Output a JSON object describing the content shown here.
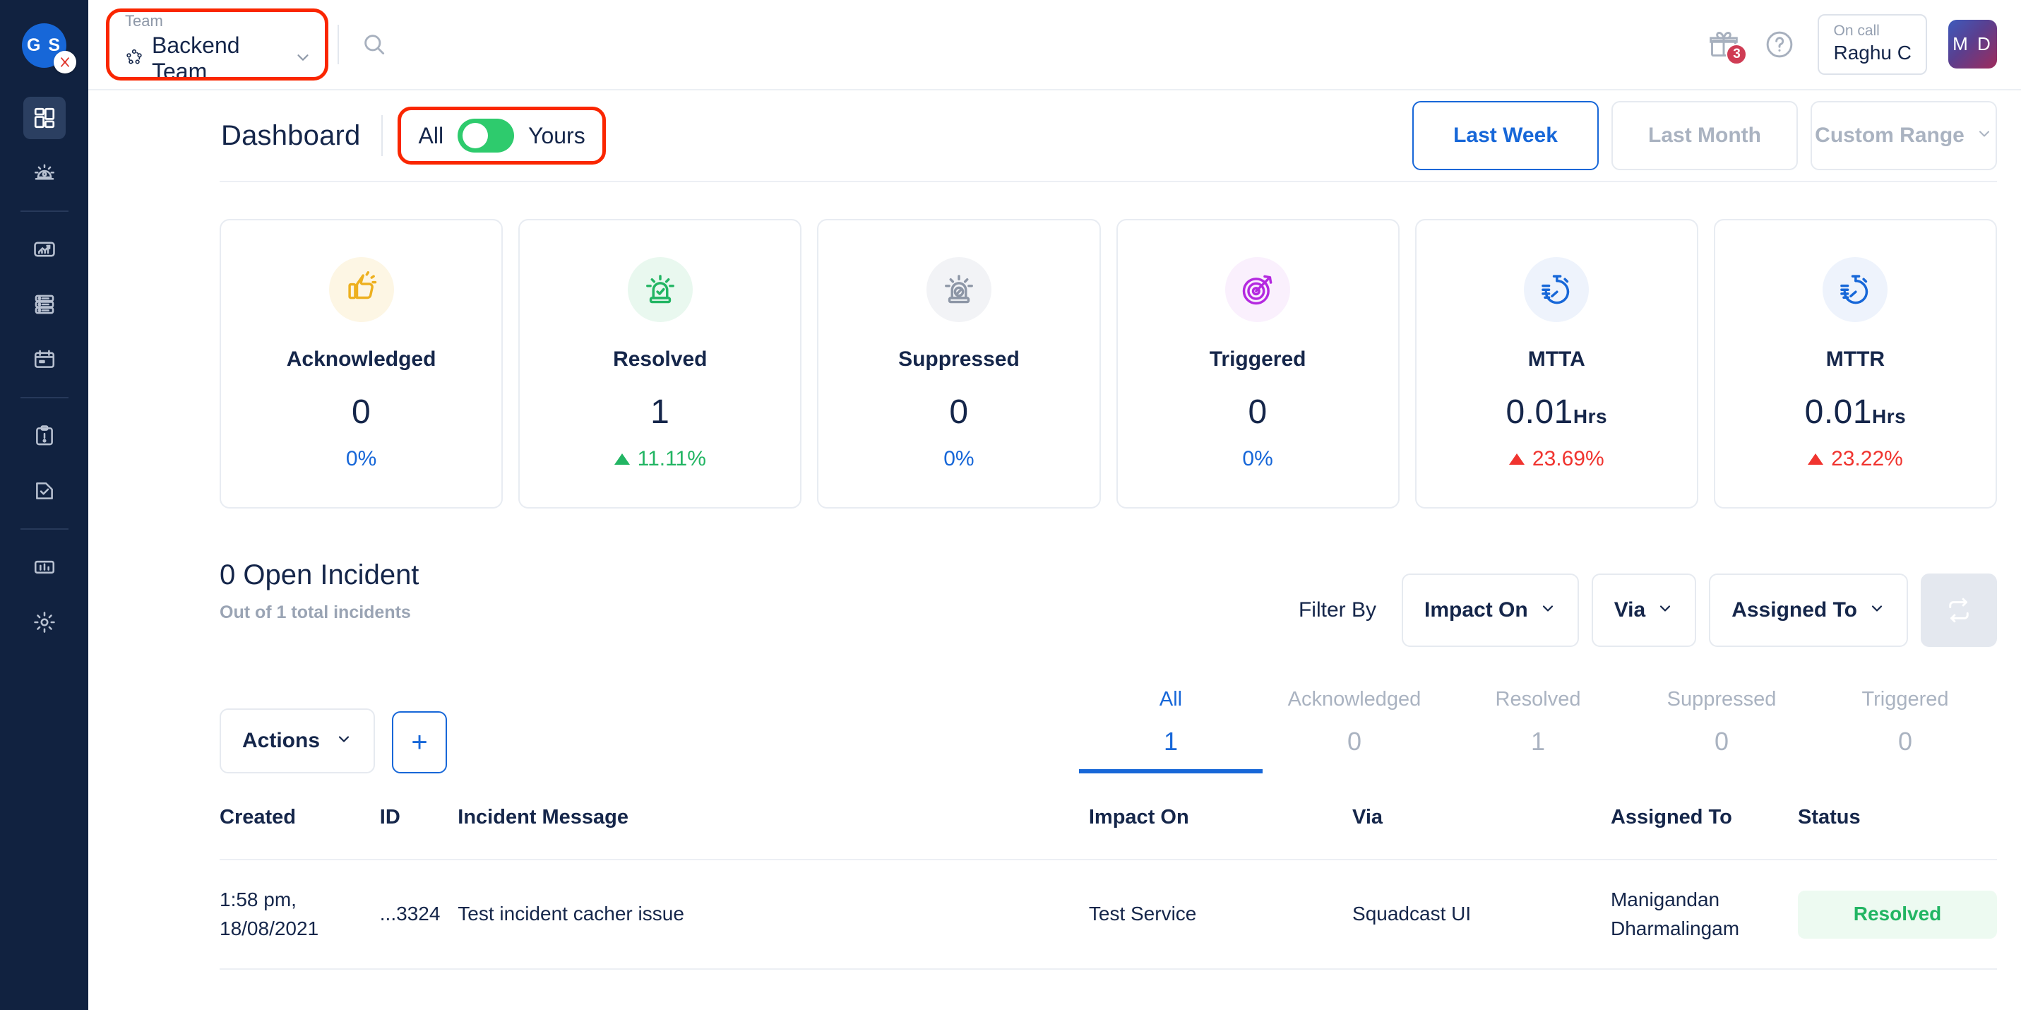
{
  "brand": {
    "logo_initials": "G S",
    "logo_color": "#1767d8",
    "badge_color": "#cf3c54"
  },
  "sidebar": {
    "items": [
      {
        "name": "dashboard",
        "icon": "dashboard-icon",
        "active": true
      },
      {
        "name": "incidents",
        "icon": "siren-icon",
        "active": false
      },
      {
        "name": "analytics-growth",
        "icon": "chart-up-icon",
        "active": false
      },
      {
        "name": "services",
        "icon": "server-stack-icon",
        "active": false
      },
      {
        "name": "schedules",
        "icon": "calendar-icon",
        "active": false
      },
      {
        "name": "runbooks",
        "icon": "clipboard-alert-icon",
        "active": false
      },
      {
        "name": "postmortems",
        "icon": "document-check-icon",
        "active": false
      },
      {
        "name": "reports",
        "icon": "bar-chart-icon",
        "active": false
      },
      {
        "name": "settings",
        "icon": "gear-icon",
        "active": false
      }
    ]
  },
  "topbar": {
    "team_label": "Team",
    "team_value": "Backend Team",
    "team_icon": "team-network-icon",
    "chevron_icon": "chevron-down-icon",
    "search_icon": "search-icon",
    "gift_icon": "gift-icon",
    "gift_badge": "3",
    "help_icon": "question-circle-icon",
    "oncall_label": "On call",
    "oncall_name": "Raghu C",
    "avatar_initials": "M D"
  },
  "page": {
    "title": "Dashboard",
    "toggle_left": "All",
    "toggle_right": "Yours",
    "toggle_state": "All",
    "toggle_color": "#2ecb6d"
  },
  "date_range": {
    "buttons": [
      {
        "label": "Last Week",
        "active": true,
        "has_chevron": false
      },
      {
        "label": "Last Month",
        "active": false,
        "has_chevron": false
      },
      {
        "label": "Custom Range",
        "active": false,
        "has_chevron": true
      }
    ],
    "active_color": "#1767d8"
  },
  "metric_cards": [
    {
      "title": "Acknowledged",
      "icon": "thumbs-up-icon",
      "icon_color": "#edb01f",
      "icon_bg": "#fdf6e4",
      "value": "0",
      "unit": "",
      "delta": "0%",
      "delta_color": "#1767d8",
      "trend": "none"
    },
    {
      "title": "Resolved",
      "icon": "siren-check-icon",
      "icon_color": "#22b563",
      "icon_bg": "#e9f8ef",
      "value": "1",
      "unit": "",
      "delta": "11.11%",
      "delta_color": "#22b563",
      "trend": "up"
    },
    {
      "title": "Suppressed",
      "icon": "siren-slash-icon",
      "icon_color": "#8d96a6",
      "icon_bg": "#f2f3f6",
      "value": "0",
      "unit": "",
      "delta": "0%",
      "delta_color": "#1767d8",
      "trend": "none"
    },
    {
      "title": "Triggered",
      "icon": "target-arrow-icon",
      "icon_color": "#b429e0",
      "icon_bg": "#faf0fd",
      "value": "0",
      "unit": "",
      "delta": "0%",
      "delta_color": "#1767d8",
      "trend": "none"
    },
    {
      "title": "MTTA",
      "icon": "stopwatch-icon",
      "icon_color": "#1767d8",
      "icon_bg": "#eef3fc",
      "value": "0.01",
      "unit": "Hrs",
      "delta": "23.69%",
      "delta_color": "#f0342f",
      "trend": "up"
    },
    {
      "title": "MTTR",
      "icon": "stopwatch-icon",
      "icon_color": "#1767d8",
      "icon_bg": "#eef3fc",
      "value": "0.01",
      "unit": "Hrs",
      "delta": "23.22%",
      "delta_color": "#f0342f",
      "trend": "up"
    }
  ],
  "incidents": {
    "heading": "0 Open Incident",
    "subheading": "Out of 1 total incidents",
    "filter_label": "Filter By",
    "filters": [
      {
        "label": "Impact On"
      },
      {
        "label": "Via"
      },
      {
        "label": "Assigned To"
      }
    ],
    "reset_icon": "repeat-refresh-icon",
    "actions_label": "Actions",
    "add_label": "+",
    "tabs": [
      {
        "label": "All",
        "count": "1",
        "active": true
      },
      {
        "label": "Acknowledged",
        "count": "0",
        "active": false
      },
      {
        "label": "Resolved",
        "count": "1",
        "active": false
      },
      {
        "label": "Suppressed",
        "count": "0",
        "active": false
      },
      {
        "label": "Triggered",
        "count": "0",
        "active": false
      }
    ],
    "columns": [
      "Created",
      "ID",
      "Incident Message",
      "Impact On",
      "Via",
      "Assigned To",
      "Status"
    ],
    "rows": [
      {
        "created": "1:58 pm, 18/08/2021",
        "id": "...3324",
        "message": "Test incident cacher issue",
        "impact_on": "Test Service",
        "via": "Squadcast UI",
        "assigned_to": "Manigandan Dharmalingam",
        "status": "Resolved",
        "status_color": "#22b563"
      }
    ]
  },
  "annotations": {
    "highlight_color": "#fa2600",
    "highlighted": [
      "team-selector",
      "all-yours-toggle"
    ]
  }
}
